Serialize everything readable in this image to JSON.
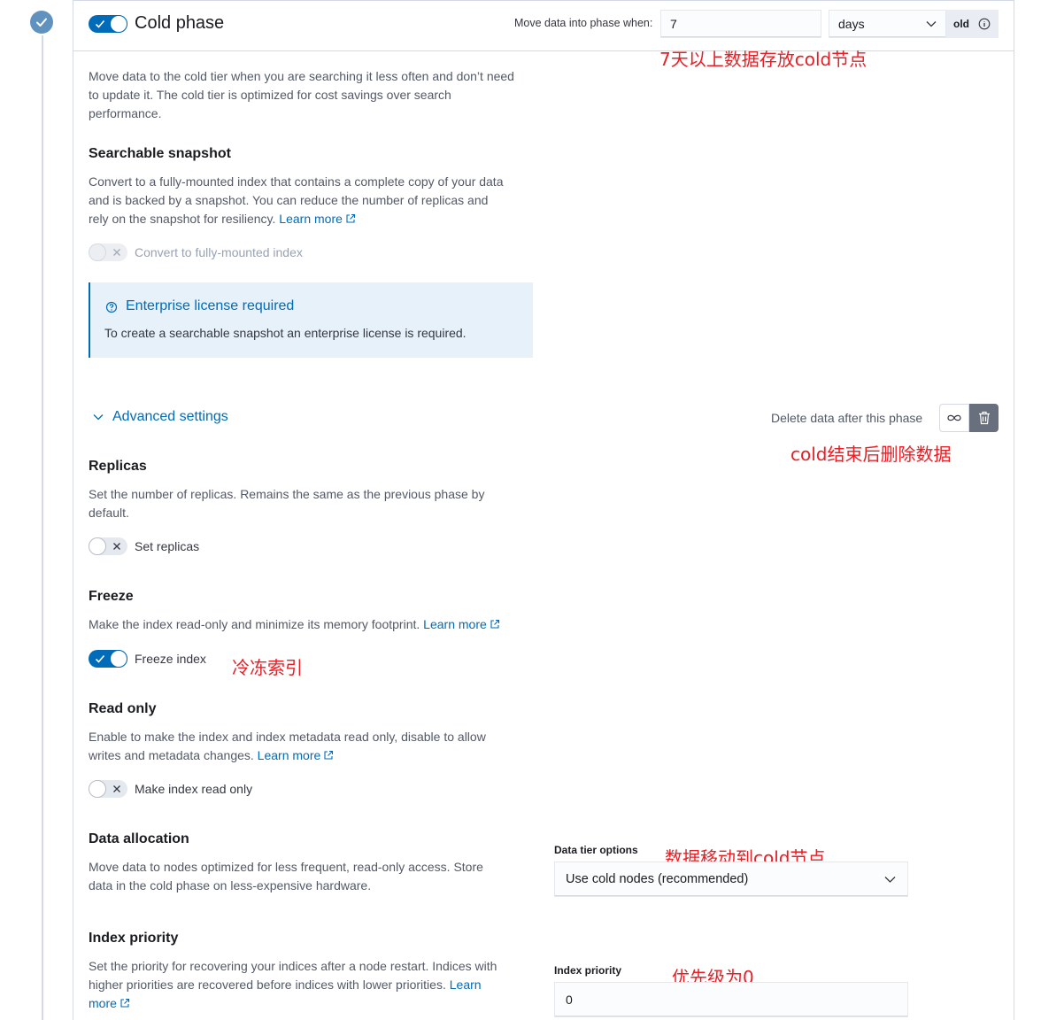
{
  "phase": {
    "title": "Cold phase",
    "enabled": true,
    "move_label": "Move data into phase when:",
    "move_value": "7",
    "move_unit": "days",
    "append": "old",
    "description_lines": [
      "Move data to the cold tier when you are searching it less often and don’t need",
      "to update it. The cold tier is optimized for cost savings over search",
      "performance."
    ]
  },
  "searchable_snapshot": {
    "heading": "Searchable snapshot",
    "line1": "Convert to a fully-mounted index that contains a complete copy of your data",
    "line2": "and is backed by a snapshot. You can reduce the number of replicas and",
    "line3": "rely on the snapshot for resiliency. ",
    "learn_more": "Learn more",
    "toggle_label": "Convert to fully-mounted index",
    "callout_title": "Enterprise license required",
    "callout_body": "To create a searchable snapshot an enterprise license is required."
  },
  "advanced": {
    "label": "Advanced settings",
    "delete_label": "Delete data after this phase"
  },
  "replicas": {
    "heading": "Replicas",
    "line1": "Set the number of replicas. Remains the same as the previous phase by",
    "line2": "default.",
    "toggle_label": "Set replicas"
  },
  "freeze": {
    "heading": "Freeze",
    "text": "Make the index read-only and minimize its memory footprint. ",
    "learn_more": "Learn more",
    "toggle_label": "Freeze index"
  },
  "read_only": {
    "heading": "Read only",
    "line1": "Enable to make the index and index metadata read only, disable to allow",
    "line2": "writes and metadata changes. ",
    "learn_more": "Learn more",
    "toggle_label": "Make index read only"
  },
  "data_allocation": {
    "heading": "Data allocation",
    "line1": "Move data to nodes optimized for less frequent, read-only access. Store",
    "line2": "data in the cold phase on less-expensive hardware.",
    "field_label": "Data tier options",
    "field_value": "Use cold nodes (recommended)"
  },
  "index_priority": {
    "heading": "Index priority",
    "line1": "Set the priority for recovering your indices after a node restart. Indices with",
    "line2": "higher priorities are recovered before indices with lower priorities. ",
    "learn_more_1": "Learn",
    "learn_more_2": "more",
    "field_label": "Index priority",
    "field_value": "0"
  },
  "annotations": {
    "move": "7天以上数据存放cold节点",
    "delete": "cold结束后删除数据",
    "freeze": "冷冻索引",
    "allocation": "数据移动到cold节点",
    "priority": "优先级为0"
  },
  "colors": {
    "primary": "#006bb8",
    "check": "#6092c0",
    "annotation": "#e81e25",
    "callout_bg": "#e6f1fa"
  },
  "icons": [
    "check-icon",
    "external-link-icon",
    "help-circle-icon",
    "chevron-down-icon",
    "info-icon",
    "infinity-icon",
    "trash-icon",
    "cross-icon"
  ]
}
